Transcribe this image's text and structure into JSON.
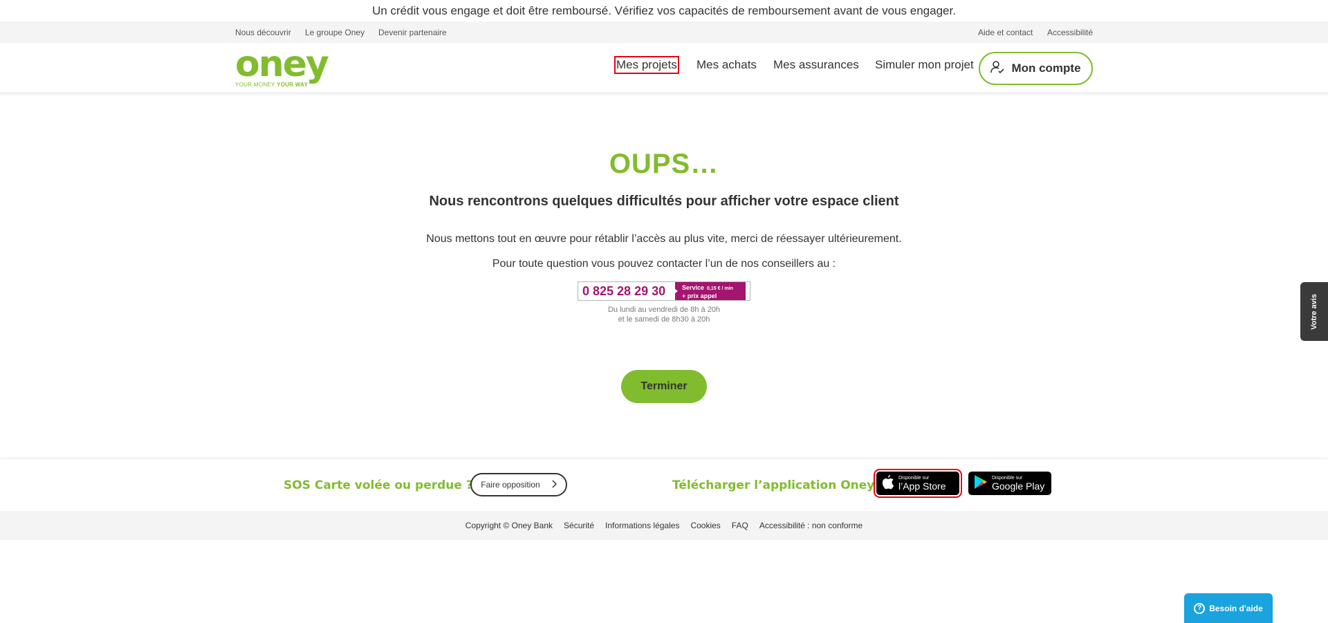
{
  "banner": "Un crédit vous engage et doit être remboursé. Vérifiez vos capacités de remboursement avant de vous engager.",
  "topbar": {
    "left_links": [
      "Nous découvrir",
      "Le groupe Oney",
      "Devenir partenaire"
    ],
    "right_links": [
      "Aide et contact",
      "Accessibilité"
    ]
  },
  "logo": {
    "word": "oney",
    "tagline_part1": "YOUR MONEY",
    "tagline_part2": "YOUR WAY"
  },
  "nav": {
    "items": [
      "Mes projets",
      "Mes achats",
      "Mes assurances",
      "Simuler mon projet"
    ],
    "account_label": "Mon compte"
  },
  "main": {
    "title": "OUPS…",
    "subtitle": "Nous rencontrons quelques difficultés pour afficher votre espace client",
    "paragraph1": "Nous mettons tout en œuvre pour rétablir l’accès au plus vite, merci de réessayer ultérieurement.",
    "paragraph2": "Pour toute question vous pouvez contacter l’un de nos conseillers au :",
    "phone": "0 825 28 29 30",
    "phone_service": "Service",
    "phone_price": "0,15 € / min",
    "phone_extra": "+ prix appel",
    "hours_line1": "Du lundi au vendredi de 8h à 20h",
    "hours_line2": "et le samedi de 8h30 à 20h",
    "finish_button": "Terminer"
  },
  "sos": {
    "title": "SOS Carte volée ou perdue ?",
    "button": "Faire opposition",
    "download_title": "Télécharger l’application Oney",
    "appstore_small": "Disponible sur",
    "appstore_big": "l’App Store",
    "googleplay_small": "Disponible sur",
    "googleplay_big": "Google Play"
  },
  "footer": {
    "links": [
      "Copyright © Oney Bank",
      "Sécurité",
      "Informations légales",
      "Cookies",
      "FAQ",
      "Accessibilité : non conforme"
    ]
  },
  "widgets": {
    "feedback": "Votre avis",
    "help": "Besoin d'aide"
  },
  "colors": {
    "brand_green": "#81bc2e",
    "phone_purple": "#a3156f",
    "help_blue": "#1aa3de",
    "highlight_red": "#e60012"
  }
}
